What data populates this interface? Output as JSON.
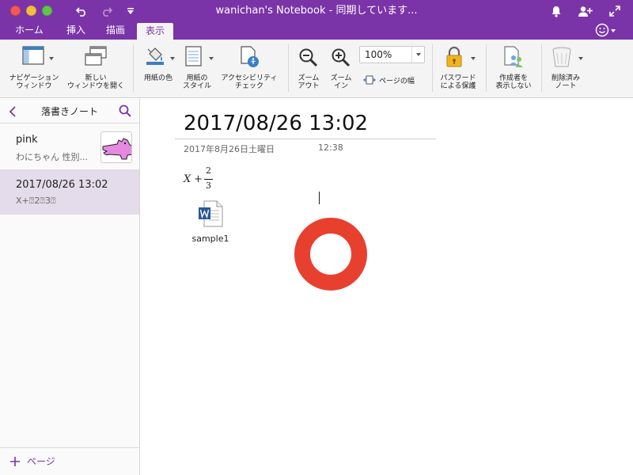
{
  "window": {
    "title": "wanichan's Notebook - 同期しています..."
  },
  "tabs": [
    {
      "label": "ホーム"
    },
    {
      "label": "挿入"
    },
    {
      "label": "描画"
    },
    {
      "label": "表示"
    }
  ],
  "ribbon": {
    "navigation_window": "ナビゲーション\nウィンドウ",
    "new_window": "新しい\nウィンドウを開く",
    "paper_color": "用紙の色",
    "paper_style": "用紙の\nスタイル",
    "accessibility_check": "アクセシビリティ\nチェック",
    "zoom_out": "ズーム\nアウト",
    "zoom_in": "ズーム\nイン",
    "zoom_value": "100%",
    "page_width": "ページの幅",
    "password_protect": "パスワード\nによる保護",
    "hide_authors": "作成者を\n表示しない",
    "deleted_notes": "削除済み\nノート"
  },
  "sidebar": {
    "section_title": "落書きノート",
    "pages": [
      {
        "title": "pink",
        "preview": "わにちゃん 性別..."
      },
      {
        "title": "2017/08/26 13:02",
        "preview": "X+⍰2⍰3⍰"
      }
    ],
    "add_page_label": "ページ"
  },
  "page": {
    "title": "2017/08/26 13:02",
    "date": "2017年8月26日土曜日",
    "time": "12:38",
    "math": {
      "variable": "X",
      "operator": "+",
      "numerator": "2",
      "denominator": "3"
    },
    "attachment": {
      "name": "sample1",
      "icon": "word-document-icon"
    },
    "shape": {
      "type": "ring",
      "color": "#e8402f"
    }
  },
  "colors": {
    "accent": "#7b34a8",
    "ribbon_bg": "#f4f4f4",
    "selected_page": "#e4dcea"
  }
}
